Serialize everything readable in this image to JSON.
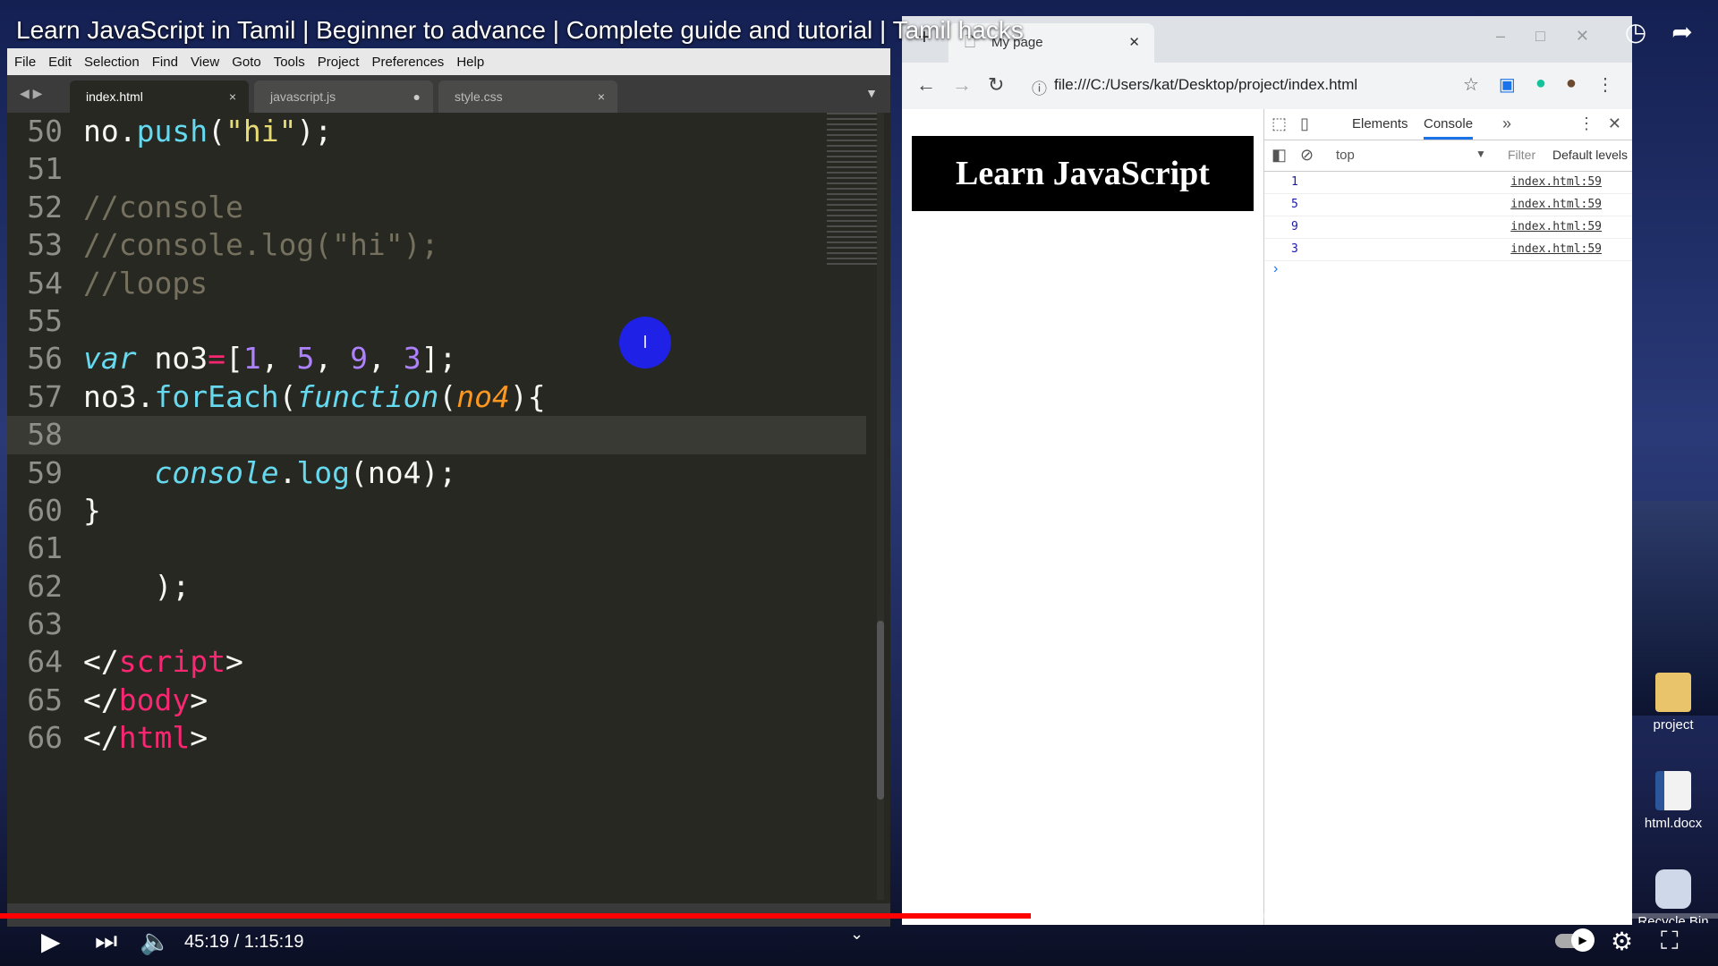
{
  "video": {
    "title": "Learn JavaScript in Tamil | Beginner to advance | Complete guide and tutorial | Tamil hacks",
    "time": "45:19 / 1:15:19",
    "progress_fraction": 0.6
  },
  "editor": {
    "menu": [
      "File",
      "Edit",
      "Selection",
      "Find",
      "View",
      "Goto",
      "Tools",
      "Project",
      "Preferences",
      "Help"
    ],
    "tabs": [
      {
        "label": "index.html",
        "close": "×"
      },
      {
        "label": "javascript.js",
        "close": "●"
      },
      {
        "label": "style.css",
        "close": "×"
      }
    ],
    "cursor_glyph": "I",
    "lines": [
      {
        "n": "50"
      },
      {
        "n": "51"
      },
      {
        "n": "52"
      },
      {
        "n": "53"
      },
      {
        "n": "54"
      },
      {
        "n": "55"
      },
      {
        "n": "56"
      },
      {
        "n": "57"
      },
      {
        "n": "58"
      },
      {
        "n": "59"
      },
      {
        "n": "60"
      },
      {
        "n": "61"
      },
      {
        "n": "62"
      },
      {
        "n": "63"
      },
      {
        "n": "64"
      },
      {
        "n": "65"
      },
      {
        "n": "66"
      }
    ],
    "code": {
      "l50_a": "no.",
      "l50_fn": "push",
      "l50_b": "(",
      "l50_str": "\"hi\"",
      "l50_c": ");",
      "l52": "//console",
      "l53": "//console.log(\"hi\");",
      "l54": "//loops",
      "l56_kw": "var",
      "l56_a": " no3",
      "l56_op": "=",
      "l56_b": "[",
      "l56_n1": "1",
      "l56_c1": ", ",
      "l56_n2": "5",
      "l56_c2": ", ",
      "l56_n3": "9",
      "l56_c3": ", ",
      "l56_n4": "3",
      "l56_d": "];",
      "l57_a": "no3.",
      "l57_fn": "forEach",
      "l57_b": "(",
      "l57_kw": "function",
      "l57_c": "(",
      "l57_p": "no4",
      "l57_d": "){",
      "l59_ind": "    ",
      "l59_kw": "console",
      "l59_a": ".",
      "l59_fn": "log",
      "l59_b": "(no4);",
      "l60": "}",
      "l62": "    );",
      "l64_a": "</",
      "l64_tag": "script",
      "l64_b": ">",
      "l65_a": "</",
      "l65_tag": "body",
      "l65_b": ">",
      "l66_a": "</",
      "l66_tag": "html",
      "l66_b": ">"
    }
  },
  "browser": {
    "tab_title": "My page",
    "url": "file:///C:/Users/kat/Desktop/project/index.html",
    "page_heading": "Learn JavaScript",
    "devtools": {
      "tabs": [
        "Elements",
        "Console"
      ],
      "context": "top",
      "filter_placeholder": "Filter",
      "levels": "Default levels",
      "logs": [
        {
          "value": "1",
          "source": "index.html:59"
        },
        {
          "value": "5",
          "source": "index.html:59"
        },
        {
          "value": "9",
          "source": "index.html:59"
        },
        {
          "value": "3",
          "source": "index.html:59"
        }
      ]
    }
  },
  "desktop": {
    "icons": [
      "project",
      "html.docx",
      "Recycle Bin"
    ]
  }
}
